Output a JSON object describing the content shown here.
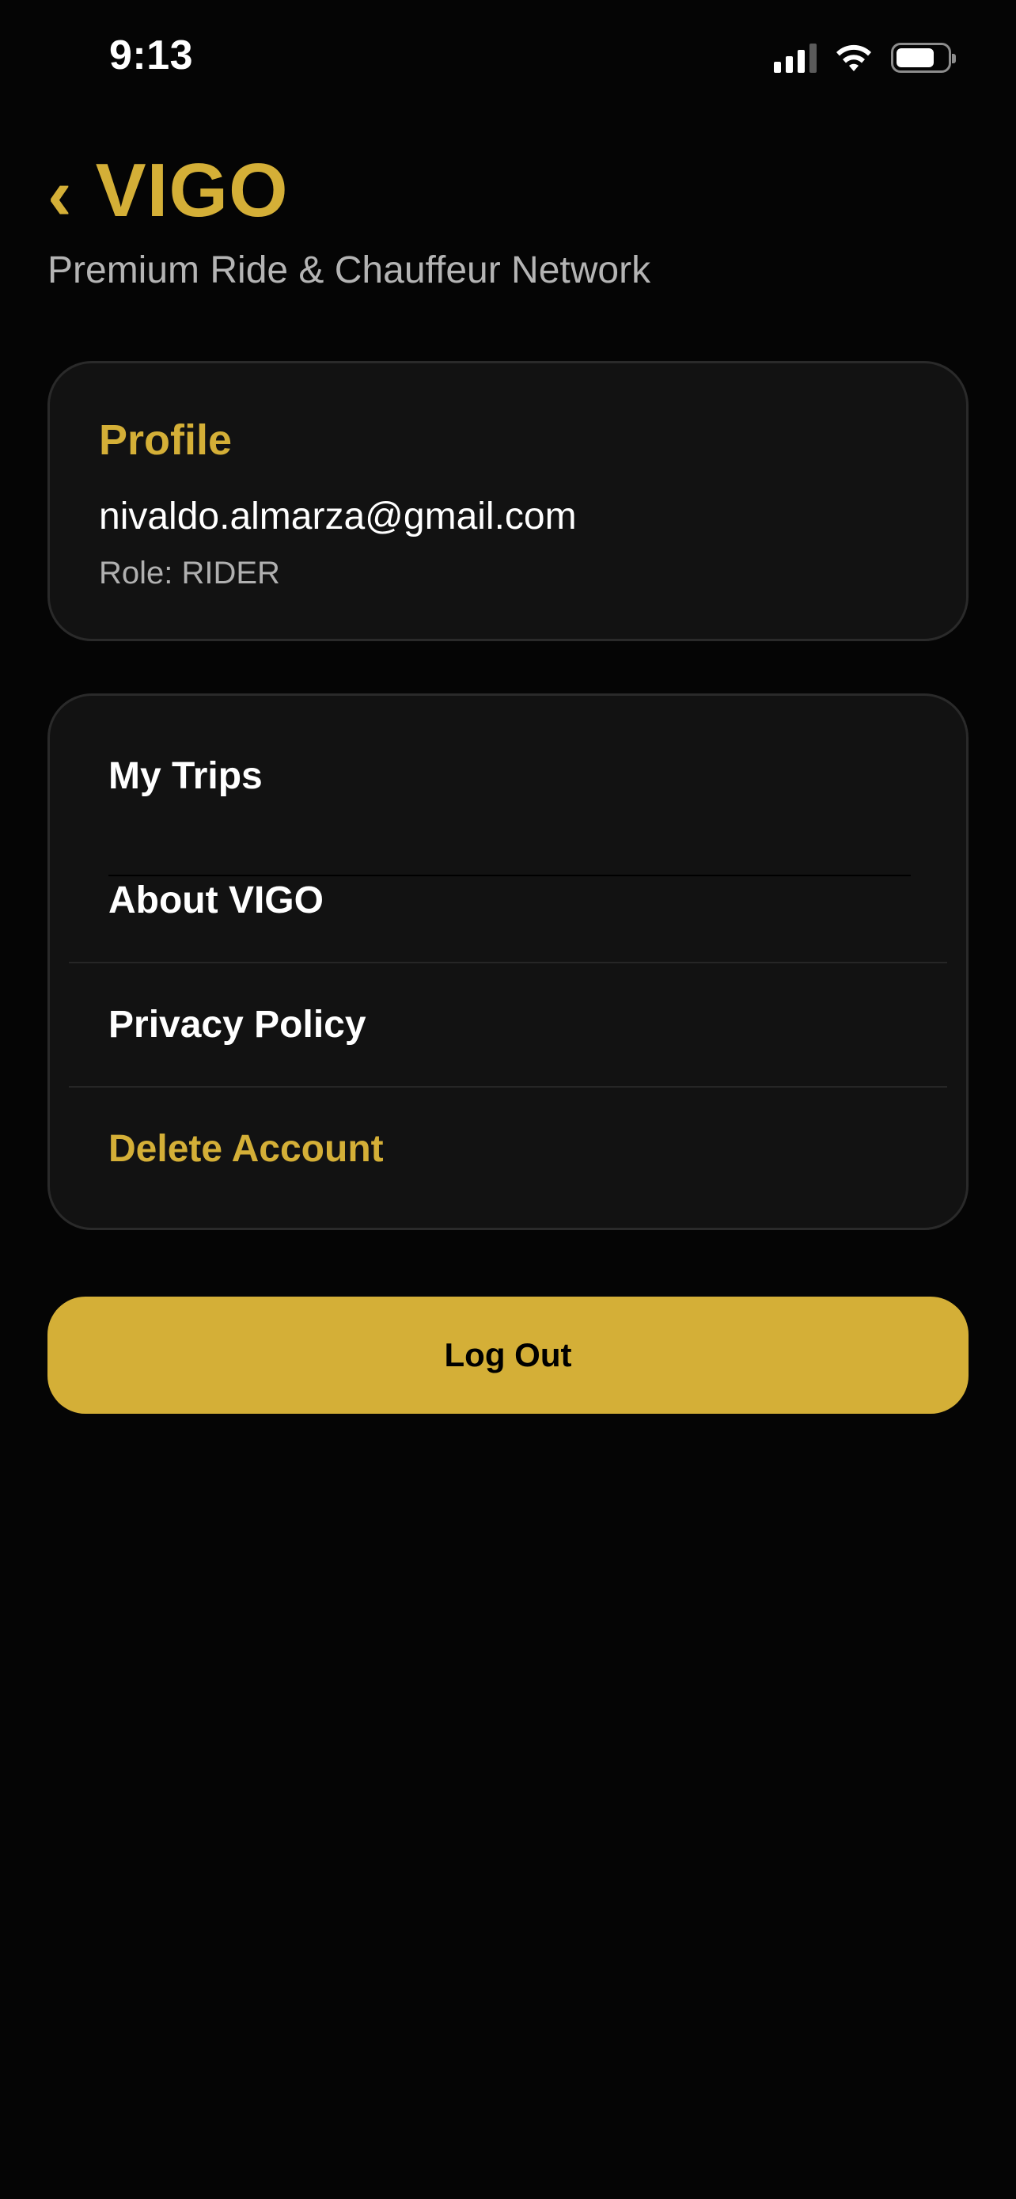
{
  "status_bar": {
    "time": "9:13"
  },
  "header": {
    "back_icon": "‹",
    "brand": "VIGO",
    "tagline": "Premium Ride & Chauffeur Network"
  },
  "profile": {
    "title": "Profile",
    "email": "nivaldo.almarza@gmail.com",
    "role": "Role: RIDER"
  },
  "menu": {
    "items": [
      {
        "label": "My Trips"
      },
      {
        "label": "About VIGO"
      },
      {
        "label": "Privacy Policy"
      },
      {
        "label": "Delete Account"
      }
    ]
  },
  "actions": {
    "logout_label": "Log Out"
  },
  "colors": {
    "accent": "#d4af37",
    "background": "#050505",
    "card": "#121212"
  }
}
